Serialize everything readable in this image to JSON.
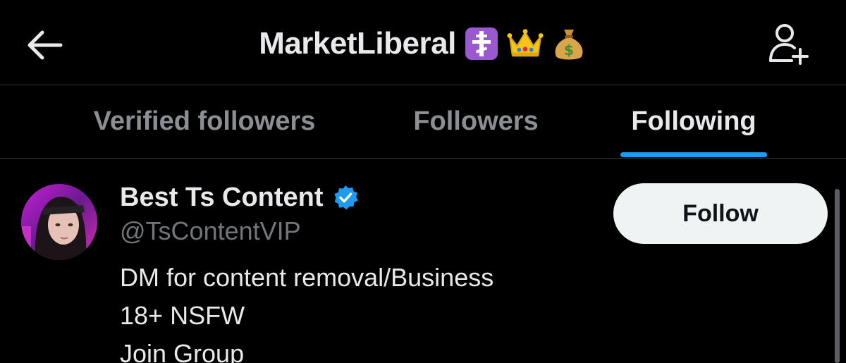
{
  "header": {
    "title": "MarketLiberal",
    "emojis": [
      "orthodox-cross-emoji",
      "crown-emoji",
      "money-bag-emoji"
    ],
    "back_icon": "arrow-left-icon",
    "add_user_icon": "add-user-icon"
  },
  "tabs": [
    {
      "label": "Verified followers",
      "active": false
    },
    {
      "label": "Followers",
      "active": false
    },
    {
      "label": "Following",
      "active": true
    }
  ],
  "list": [
    {
      "name": "Best Ts Content",
      "verified": true,
      "handle": "@TsContentVIP",
      "bio_lines": [
        "DM for content removal/Business",
        "18+ NSFW",
        "Join Group"
      ],
      "follow_label": "Follow"
    }
  ],
  "colors": {
    "background": "#000000",
    "accent": "#1d9bf0",
    "text_primary": "#e7e9ea",
    "text_secondary": "#71767b",
    "button_bg": "#eff3f4"
  }
}
